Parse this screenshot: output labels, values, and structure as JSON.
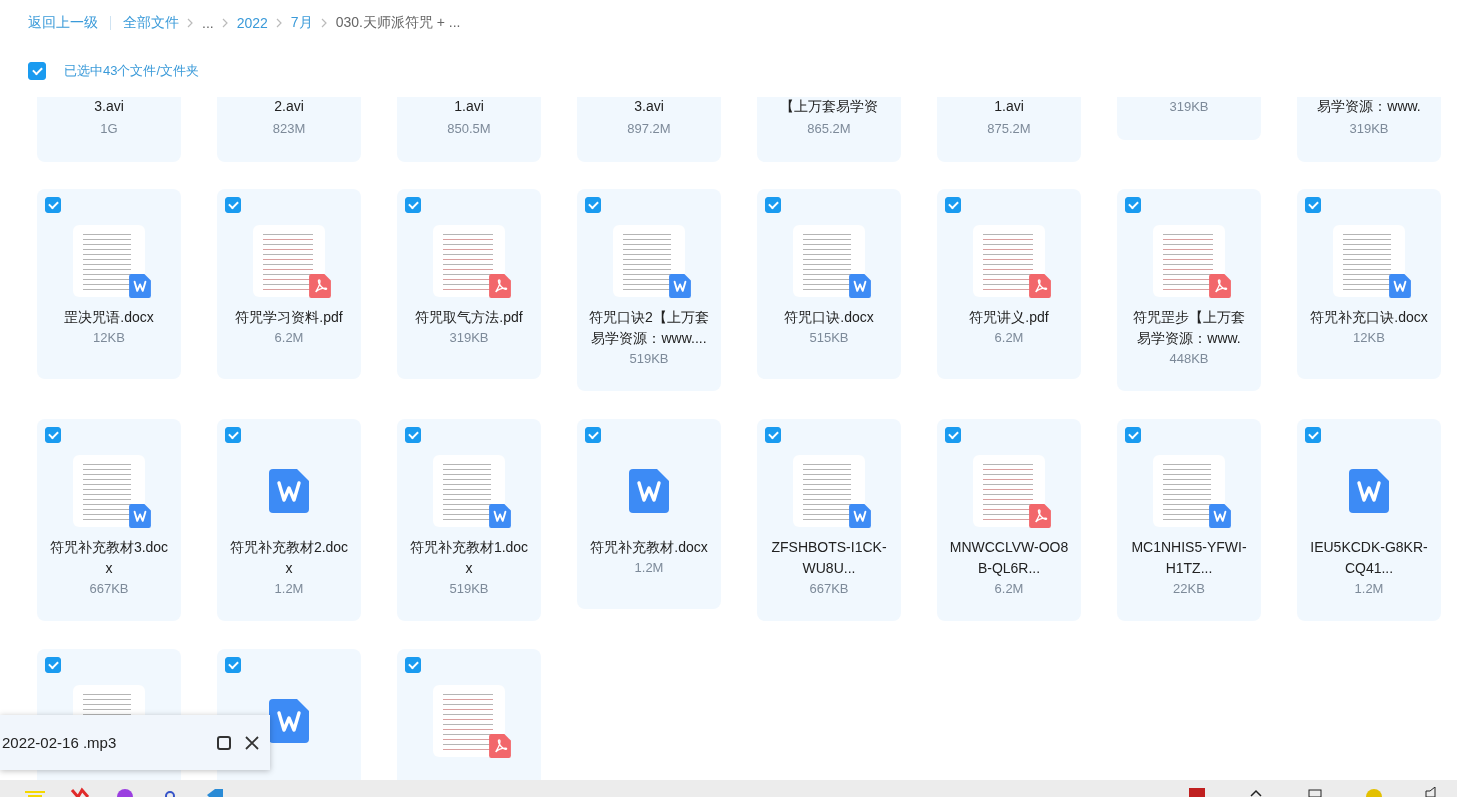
{
  "breadcrumb": {
    "back": "返回上一级",
    "items": [
      {
        "label": "全部文件",
        "current": false
      },
      {
        "label": "...",
        "current": true
      },
      {
        "label": "2022",
        "current": false
      },
      {
        "label": "7月",
        "current": false
      },
      {
        "label": "030.天师派符咒 + ...",
        "current": true
      }
    ]
  },
  "selection": {
    "checked": true,
    "label": "已选中43个文件/文件夹"
  },
  "top_row_items": [
    {
      "name": "3.avi",
      "size": "1G"
    },
    {
      "name": "2.avi",
      "size": "823M"
    },
    {
      "name": "1.avi",
      "size": "850.5M"
    },
    {
      "name": "3.avi",
      "size": "897.2M"
    },
    {
      "name": "【上万套易学资",
      "size": "865.2M"
    },
    {
      "name": "1.avi",
      "size": "875.2M"
    },
    {
      "size": "319KB"
    },
    {
      "name": "易学资源：www.",
      "size": "319KB"
    }
  ],
  "files": [
    {
      "kind": "doc",
      "selected": true,
      "name": "罡决咒语.docx",
      "size": "12KB"
    },
    {
      "kind": "pdf",
      "selected": true,
      "name": "符咒学习资料.pdf",
      "size": "6.2M"
    },
    {
      "kind": "pdf",
      "selected": true,
      "name": "符咒取气方法.pdf",
      "size": "319KB"
    },
    {
      "kind": "doc",
      "selected": true,
      "name": "符咒口诀2【上万套易学资源：www....",
      "size": "519KB"
    },
    {
      "kind": "doc",
      "selected": true,
      "name": "符咒口诀.docx",
      "size": "515KB"
    },
    {
      "kind": "pdf",
      "selected": true,
      "name": "符咒讲义.pdf",
      "size": "6.2M"
    },
    {
      "kind": "pdf",
      "selected": true,
      "name": "符咒罡步【上万套易学资源：www.",
      "size": "448KB"
    },
    {
      "kind": "doc",
      "selected": true,
      "name": "符咒补充口诀.docx",
      "size": "12KB"
    },
    {
      "kind": "doc",
      "selected": true,
      "name": "符咒补充教材3.docx",
      "size": "667KB"
    },
    {
      "kind": "word",
      "selected": true,
      "name": "符咒补充教材2.docx",
      "size": "1.2M"
    },
    {
      "kind": "doc",
      "selected": true,
      "name": "符咒补充教材1.docx",
      "size": "519KB"
    },
    {
      "kind": "word",
      "selected": true,
      "name": "符咒补充教材.docx",
      "size": "1.2M"
    },
    {
      "kind": "doc",
      "selected": true,
      "name": "ZFSHBOTS-I1CK-WU8U...",
      "size": "667KB"
    },
    {
      "kind": "pdf",
      "selected": true,
      "name": "MNWCCLVW-OO8B-QL6R...",
      "size": "6.2M"
    },
    {
      "kind": "doc",
      "selected": true,
      "name": "MC1NHIS5-YFWI-H1TZ...",
      "size": "22KB"
    },
    {
      "kind": "word",
      "selected": true,
      "name": "IEU5KCDK-G8KR-CQ41...",
      "size": "1.2M"
    }
  ],
  "bottom_row_items": [
    {
      "kind": "doc",
      "selected": true
    },
    {
      "kind": "word",
      "selected": true
    },
    {
      "kind": "pdf",
      "selected": true
    }
  ],
  "mini_player": {
    "title": "2022-02-16 .mp3"
  }
}
